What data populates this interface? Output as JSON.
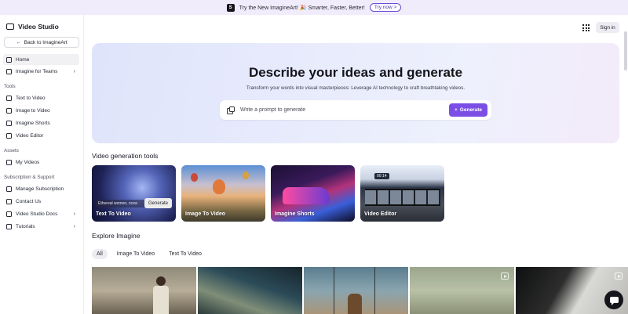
{
  "banner": {
    "logo": "S",
    "text": "Try the New ImagineArt! 🎉 Smarter, Faster, Better!",
    "cta": "Try now >"
  },
  "sidebar": {
    "brand": "Video Studio",
    "back": "Back to ImagineArt",
    "main": [
      {
        "label": "Home",
        "chevron": ""
      },
      {
        "label": "Imagine for Teams",
        "chevron": "›"
      }
    ],
    "tools_label": "Tools",
    "tools": [
      {
        "label": "Text to Video"
      },
      {
        "label": "Image to Video"
      },
      {
        "label": "Imagine Shorts"
      },
      {
        "label": "Video Editor"
      }
    ],
    "assets_label": "Assets",
    "assets": [
      {
        "label": "My Videos"
      }
    ],
    "support_label": "Subscription & Support",
    "support": [
      {
        "label": "Manage Subscription",
        "chevron": ""
      },
      {
        "label": "Contact Us",
        "chevron": ""
      },
      {
        "label": "Video Studio Docs",
        "chevron": "›"
      },
      {
        "label": "Tutorials",
        "chevron": "›"
      }
    ]
  },
  "header": {
    "signin": "Sign in",
    "apps_icon": "grid-icon"
  },
  "hero": {
    "title": "Describe your ideas and generate",
    "subtitle": "Transform your words into visual masterpieces: Leverage AI technology to craft breathtaking videos.",
    "placeholder": "Write a prompt to generate",
    "generate": "Generate"
  },
  "tools_section": {
    "title": "Video generation tools",
    "cards": [
      {
        "label": "Text To Video",
        "prompt_preview": "Ethereal women, ocea",
        "button": "Generate"
      },
      {
        "label": "Image To Video"
      },
      {
        "label": "Imagine Shorts"
      },
      {
        "label": "Video Editor",
        "timecode": "00:14"
      }
    ]
  },
  "explore": {
    "title": "Explore Imagine",
    "filters": [
      "All",
      "Image To Video",
      "Text To Video"
    ]
  },
  "colors": {
    "accent": "#7b4fe6",
    "banner_bg": "#f1ecfb"
  }
}
